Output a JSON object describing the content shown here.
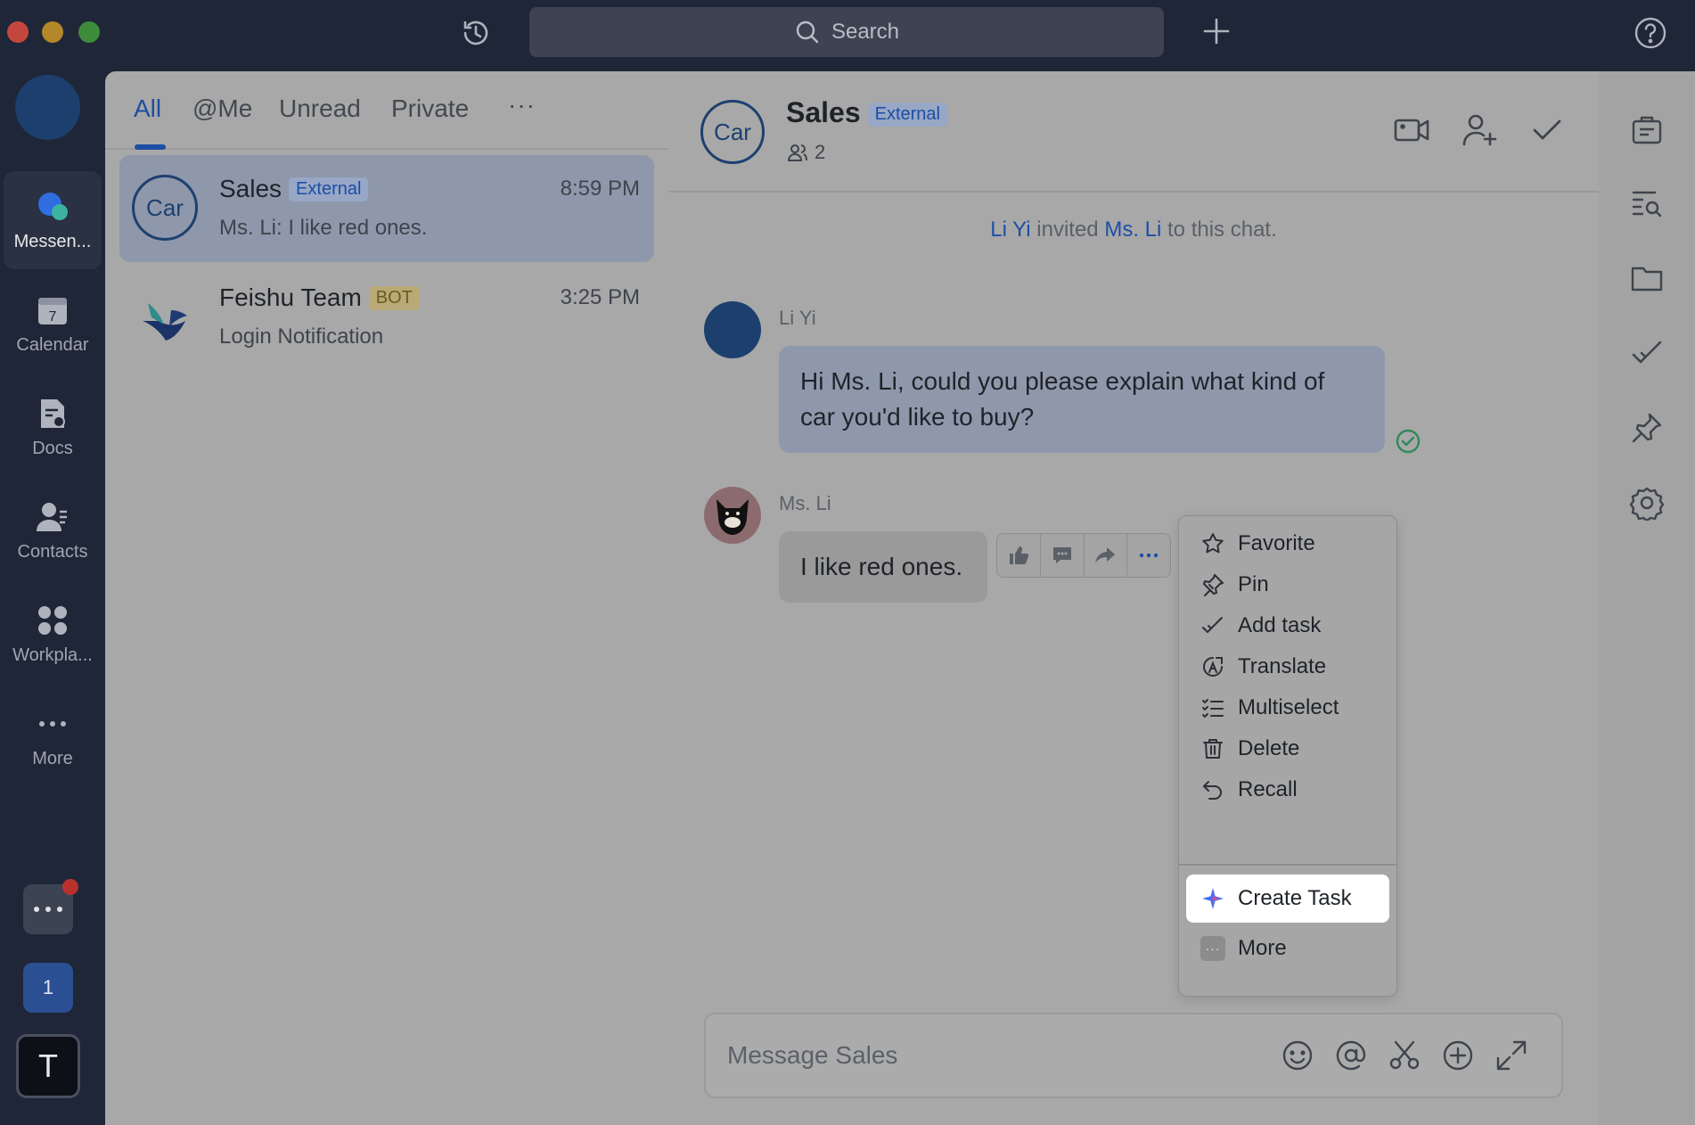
{
  "top_bar": {
    "search_placeholder": "Search"
  },
  "rail": {
    "items": [
      {
        "label": "Messen...",
        "icon": "messenger-icon",
        "active": true
      },
      {
        "label": "Calendar",
        "icon": "calendar-icon",
        "date": "7"
      },
      {
        "label": "Docs",
        "icon": "docs-icon"
      },
      {
        "label": "Contacts",
        "icon": "contacts-icon"
      },
      {
        "label": "Workpla...",
        "icon": "workplace-icon"
      },
      {
        "label": "More",
        "icon": "more-dots-icon"
      }
    ],
    "bottom": {
      "window_badge_count": "1",
      "profile_initial": "T"
    }
  },
  "chat_list": {
    "tabs": [
      "All",
      "@Me",
      "Unread",
      "Private"
    ],
    "active_tab": "All",
    "more_glyph": "···",
    "chats": [
      {
        "name": "Sales",
        "tag": "External",
        "time": "8:59 PM",
        "preview": "Ms. Li: I like red ones.",
        "avatar_text": "Car",
        "selected": true
      },
      {
        "name": "Feishu Team",
        "tag": "BOT",
        "time": "3:25 PM",
        "preview": "Login Notification",
        "avatar_icon": "feishu-logo-icon"
      }
    ]
  },
  "conversation": {
    "header": {
      "avatar_text": "Car",
      "title": "Sales",
      "tag": "External",
      "member_count": "2"
    },
    "system_message": {
      "actor": "Li Yi",
      "verb": "invited",
      "target": "Ms. Li",
      "suffix": "to this chat."
    },
    "messages": [
      {
        "sender": "Li Yi",
        "text": "Hi Ms. Li, could you please explain what kind of car you'd like to buy?"
      },
      {
        "sender": "Ms. Li",
        "text": "I like red ones."
      }
    ],
    "context_menu": {
      "items": [
        {
          "label": "Favorite",
          "icon": "star-icon"
        },
        {
          "label": "Pin",
          "icon": "pin-icon"
        },
        {
          "label": "Add task",
          "icon": "add-task-icon"
        },
        {
          "label": "Translate",
          "icon": "translate-icon"
        },
        {
          "label": "Multiselect",
          "icon": "multiselect-icon"
        },
        {
          "label": "Delete",
          "icon": "trash-icon"
        },
        {
          "label": "Recall",
          "icon": "recall-icon"
        }
      ],
      "extra_items": [
        {
          "label": "Create Task",
          "icon": "ai-sparkle-icon",
          "highlighted": true
        },
        {
          "label": "More",
          "icon": "more-square-icon"
        }
      ]
    },
    "composer": {
      "placeholder": "Message Sales"
    }
  },
  "colors": {
    "accent": "#1d4ea5",
    "sidebar": "#1f2637",
    "overlay_gray": "#a8a8a8",
    "selected_row": "#8f98ab",
    "read_check": "#2f8a5a"
  }
}
